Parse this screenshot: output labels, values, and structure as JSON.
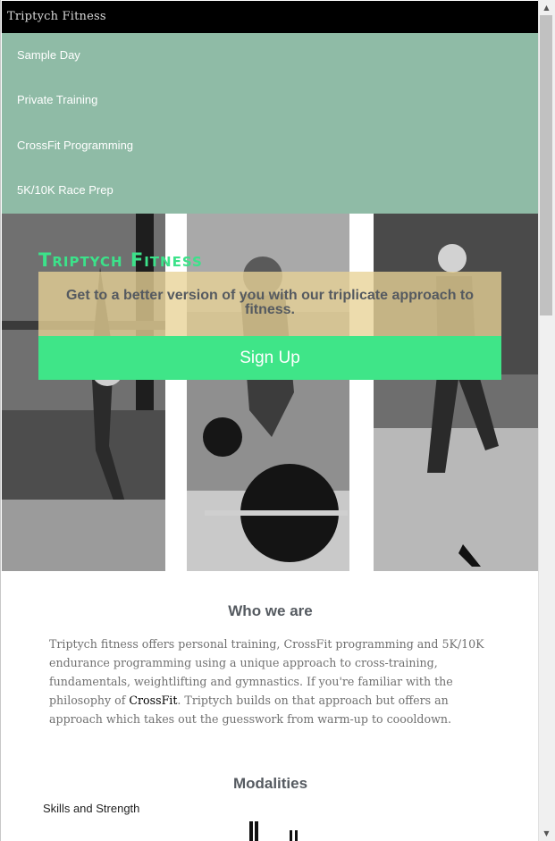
{
  "topbar": {
    "brand": "Triptych Fitness"
  },
  "nav": {
    "items": [
      {
        "label": "Sample Day"
      },
      {
        "label": "Private Training"
      },
      {
        "label": "CrossFit Programming"
      },
      {
        "label": "5K/10K Race Prep"
      }
    ]
  },
  "hero": {
    "title": "Triptych Fitness",
    "tagline": "Get to a better version of you with our triplicate approach to fitness.",
    "signup_label": "Sign Up"
  },
  "about": {
    "heading": "Who we are",
    "text_before_link": "Triptych fitness offers personal training, CrossFit programming and 5K/10K endurance programming using a unique approach to cross-training, fundamentals, weightlifting and gymnastics. If you're familiar with the philosophy of ",
    "link_text": "CrossFit",
    "text_after_link": ". Triptych builds on that approach but offers an approach which takes out the guesswork from warm-up to coooldown."
  },
  "modalities": {
    "heading": "Modalities",
    "first_item": "Skills and Strength"
  },
  "colors": {
    "topbar_bg": "#000000",
    "nav_bg": "#8fbba6",
    "accent_green": "#3fe588",
    "tagline_bg": "#e8d296"
  }
}
